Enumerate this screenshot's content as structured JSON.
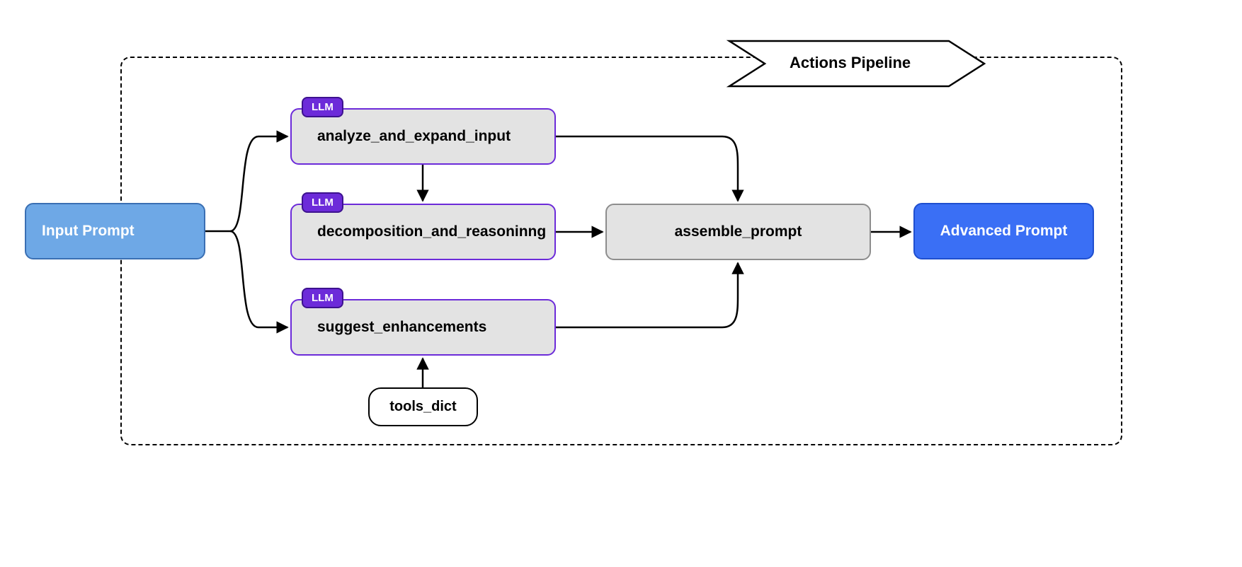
{
  "pipeline": {
    "title": "Actions Pipeline"
  },
  "nodes": {
    "input": "Input Prompt",
    "analyze": "analyze_and_expand_input",
    "decompose": "decomposition_and_reasoninng",
    "suggest": "suggest_enhancements",
    "tools": "tools_dict",
    "assemble": "assemble_prompt",
    "output": "Advanced Prompt"
  },
  "badges": {
    "llm": "LLM"
  }
}
